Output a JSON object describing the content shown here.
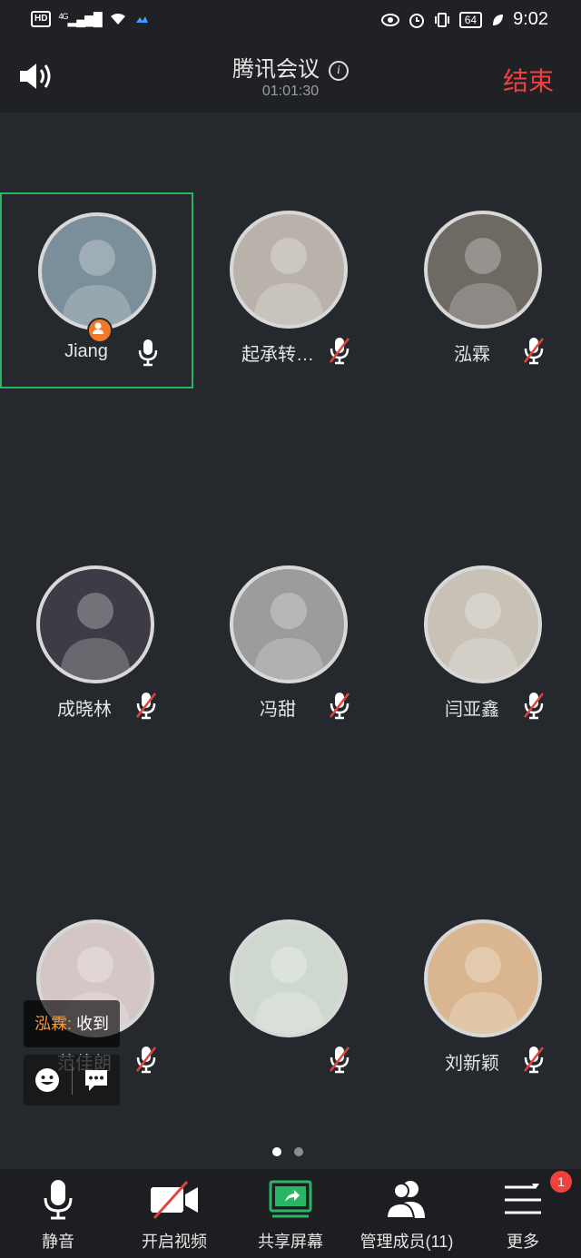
{
  "status_bar": {
    "left_indicators": [
      "HD",
      "4G"
    ],
    "battery": "64",
    "time": "9:02"
  },
  "header": {
    "title": "腾讯会议",
    "timer": "01:01:30",
    "end_label": "结束",
    "end_color": "#f0413d"
  },
  "participants": [
    {
      "name": "Jiang",
      "muted": false,
      "host": true,
      "active": true,
      "avatar_color": "#7a8f9a"
    },
    {
      "name": "起承转…",
      "muted": true,
      "host": false,
      "active": false,
      "avatar_color": "#b9b2aa"
    },
    {
      "name": "泓霖",
      "muted": true,
      "host": false,
      "active": false,
      "avatar_color": "#6e6a63"
    },
    {
      "name": "成晓林",
      "muted": true,
      "host": false,
      "active": false,
      "avatar_color": "#3f3b46"
    },
    {
      "name": "冯甜",
      "muted": true,
      "host": false,
      "active": false,
      "avatar_color": "#9c9c9c"
    },
    {
      "name": "闫亚鑫",
      "muted": true,
      "host": false,
      "active": false,
      "avatar_color": "#c8c2b6"
    },
    {
      "name": "范佳朗",
      "muted": true,
      "host": false,
      "active": false,
      "avatar_color": "#d4c6c4"
    },
    {
      "name": "",
      "muted": true,
      "host": false,
      "active": false,
      "avatar_color": "#cfd8cf"
    },
    {
      "name": "刘新颖",
      "muted": true,
      "host": false,
      "active": false,
      "avatar_color": "#d9b68f"
    }
  ],
  "chat": {
    "sender": "泓霖",
    "message": "收到"
  },
  "pager": {
    "pages": 2,
    "current": 1
  },
  "toolbar": [
    {
      "label": "静音",
      "icon": "microphone-icon"
    },
    {
      "label": "开启视频",
      "icon": "video-off-icon"
    },
    {
      "label": "共享屏幕",
      "icon": "share-screen-icon",
      "color": "#2ab566"
    },
    {
      "label": "管理成员(11)",
      "icon": "members-icon"
    },
    {
      "label": "更多",
      "icon": "more-icon",
      "badge": "1"
    }
  ],
  "colors": {
    "background": "#25282c",
    "active_border": "#2ab566",
    "host_badge": "#f07a2a",
    "mute_slash": "#e0453f"
  }
}
